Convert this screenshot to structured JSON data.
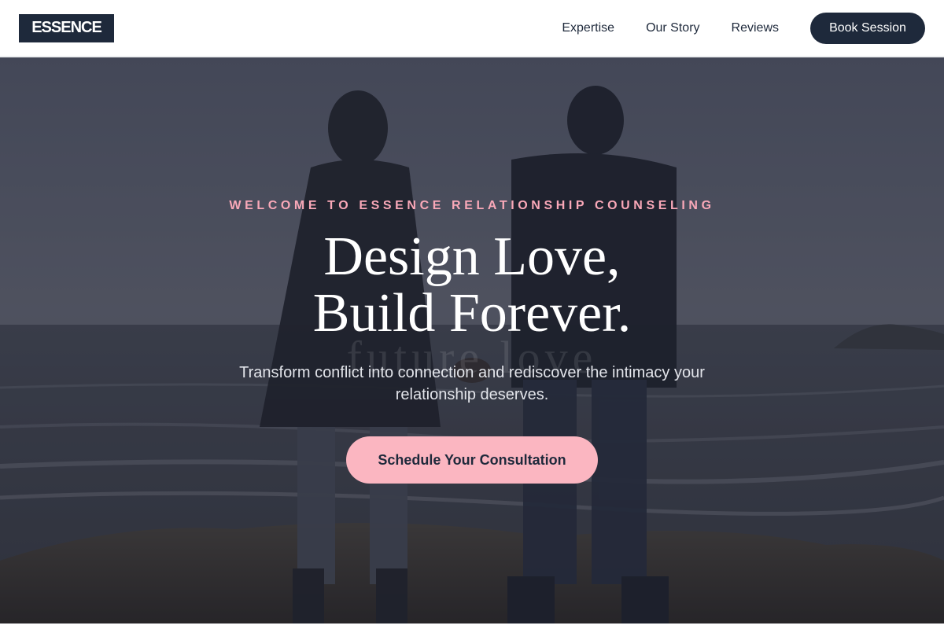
{
  "brand": {
    "logo_text": "ESSENCE"
  },
  "nav": {
    "links": [
      "Expertise",
      "Our Story",
      "Reviews"
    ],
    "cta_label": "Book Session"
  },
  "hero": {
    "eyebrow": "WELCOME TO ESSENCE RELATIONSHIP COUNSELING",
    "headline_line1": "Design Love,",
    "headline_line2": "Build Forever.",
    "ghost_text": "future love",
    "subtitle": "Transform conflict into connection and rediscover the intimacy your relationship deserves.",
    "cta_label": "Schedule Your Consultation",
    "image_description": "couple-holding-hands-on-rocky-shore-icon"
  },
  "colors": {
    "brand_navy": "#1e293b",
    "accent_pink": "#fbb6c1",
    "eyebrow_pink": "#f9a8b8"
  }
}
